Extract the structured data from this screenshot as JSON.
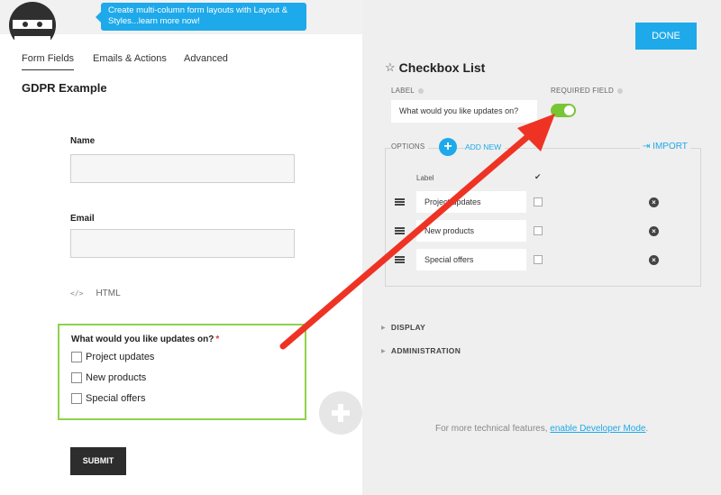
{
  "promo": {
    "text": "Create multi-column form layouts with Layout & Styles...learn more now!"
  },
  "tabs": [
    {
      "label": "Form Fields"
    },
    {
      "label": "Emails & Actions"
    },
    {
      "label": "Advanced"
    }
  ],
  "form": {
    "title": "GDPR Example",
    "fields": {
      "name_label": "Name",
      "email_label": "Email",
      "html_label": "HTML",
      "html_icon": "</>"
    },
    "checkbox_field": {
      "question": "What would you like updates on?",
      "required_mark": "*",
      "options": [
        "Project updates",
        "New products",
        "Special offers"
      ]
    },
    "submit_label": "SUBMIT"
  },
  "settings": {
    "done_label": "DONE",
    "panel_title": "Checkbox List",
    "label_caption": "LABEL",
    "label_value": "What would you like updates on?",
    "required_caption": "REQUIRED FIELD",
    "required_on": true,
    "options_caption": "OPTIONS",
    "add_new_label": "ADD NEW",
    "import_label": "IMPORT",
    "col_label": "Label",
    "col_check": "✔",
    "option_rows": [
      {
        "label": "Project updates"
      },
      {
        "label": "New products"
      },
      {
        "label": "Special offers"
      }
    ],
    "sections": [
      "DISPLAY",
      "ADMINISTRATION"
    ],
    "footer_prefix": "For more technical features, ",
    "footer_link": "enable Developer Mode",
    "footer_suffix": "."
  },
  "colors": {
    "accent": "#1ea9ea",
    "toggle_on": "#7ac536",
    "highlight_border": "#8fd24c",
    "arrow": "#ee3324"
  }
}
